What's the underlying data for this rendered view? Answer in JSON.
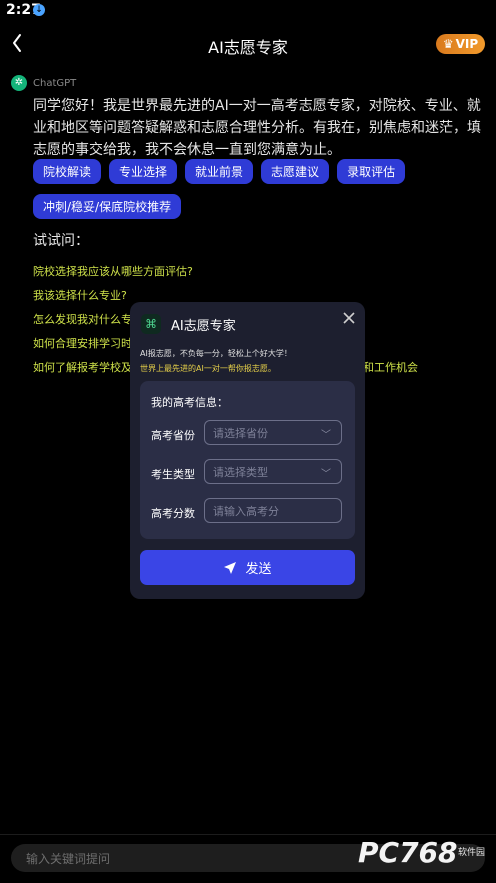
{
  "status": {
    "time": "2:27",
    "indicator": "down-arrow-icon"
  },
  "header": {
    "title": "AI志愿专家",
    "vip_label": "VIP"
  },
  "bot": {
    "name": "ChatGPT"
  },
  "intro": "同学您好！我是世界最先进的AI一对一高考志愿专家，对院校、专业、就业和地区等问题答疑解惑和志愿合理性分析。有我在，别焦虑和迷茫，填志愿的事交给我，我不会休息一直到您满意为止。",
  "chips": [
    "院校解读",
    "专业选择",
    "就业前景",
    "志愿建议",
    "录取评估",
    "冲刺/稳妥/保底院校推荐"
  ],
  "try_label": "试试问：",
  "questions": [
    "院校选择我应该从哪些方面评估?",
    "我该选择什么专业?",
    "怎么发现我对什么专",
    "如何合理安排学习时",
    "如何了解报考学校及",
    "和工作机会"
  ],
  "modal": {
    "title": "AI志愿专家",
    "sub1": "AI报志愿，不负每一分，轻松上个好大学！",
    "sub2": "世界上最先进的AI一对一帮你报志愿。",
    "card_title": "我的高考信息：",
    "province_label": "高考省份",
    "province_placeholder": "请选择省份",
    "type_label": "考生类型",
    "type_placeholder": "请选择类型",
    "score_label": "高考分数",
    "score_placeholder": "请输入高考分",
    "send_label": "发送"
  },
  "input_placeholder": "输入关键词提问",
  "watermark": {
    "text": "PC768",
    "small": "软件园"
  },
  "colors": {
    "accent": "#3a45e6",
    "chip": "#2f3bd6",
    "question": "#cfe24a",
    "vip": "#f19a2c"
  }
}
